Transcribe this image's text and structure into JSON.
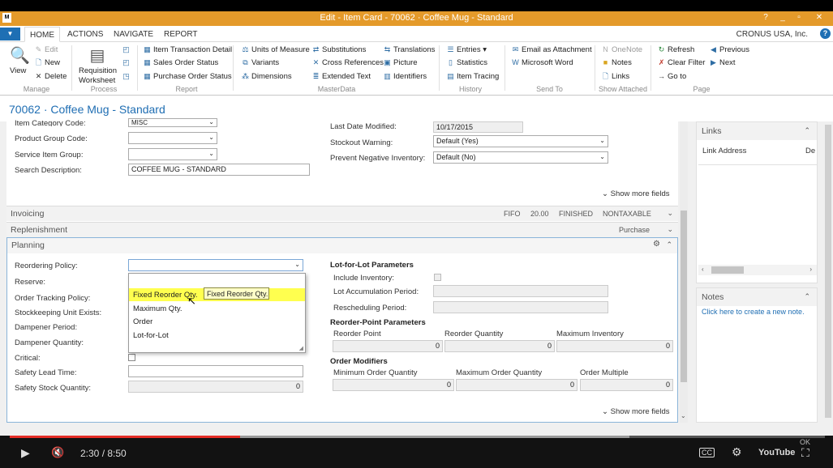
{
  "window": {
    "title": "Edit - Item Card - 70062 · Coffee Mug - Standard",
    "controls": [
      "?",
      "_",
      "▫",
      "✕"
    ]
  },
  "ribbon_tabs": {
    "app_menu_icon": "▼",
    "tabs": [
      "HOME",
      "ACTIONS",
      "NAVIGATE",
      "REPORT"
    ],
    "company": "CRONUS USA, Inc.",
    "help": "?"
  },
  "ribbon": {
    "manage": {
      "view": "View",
      "edit": "Edit",
      "new": "New",
      "delete": "Delete",
      "group": "Manage"
    },
    "process": {
      "requisition": "Requisition",
      "worksheet": "Worksheet",
      "group": "Process"
    },
    "report": {
      "items": [
        "Item Transaction Detail",
        "Sales Order Status",
        "Purchase Order Status"
      ],
      "group": "Report"
    },
    "masterdata": {
      "col1": [
        "Units of Measure",
        "Variants",
        "Dimensions"
      ],
      "col2": [
        "Substitutions",
        "Cross References",
        "Extended Text"
      ],
      "col3": [
        "Translations",
        "Picture",
        "Identifiers"
      ],
      "group": "MasterData"
    },
    "history": {
      "items": [
        "Entries ▾",
        "Statistics",
        "Item Tracing"
      ],
      "group": "History"
    },
    "sendto": {
      "items": [
        "Email as Attachment",
        "Microsoft Word"
      ],
      "group": "Send To"
    },
    "showattached": {
      "items": [
        "OneNote",
        "Notes",
        "Links"
      ],
      "group": "Show Attached"
    },
    "page": {
      "col1": [
        "Refresh",
        "Clear Filter",
        "Go to"
      ],
      "col2": [
        "Previous",
        "Next"
      ],
      "group": "Page"
    }
  },
  "page_title": "70062 · Coffee Mug - Standard",
  "general": {
    "item_category_label": "Item Category Code:",
    "item_category_value": "MISC",
    "product_group_label": "Product Group Code:",
    "service_item_group_label": "Service Item Group:",
    "search_description_label": "Search Description:",
    "search_description_value": "COFFEE MUG - STANDARD",
    "last_modified_label": "Last Date Modified:",
    "last_modified_value": "10/17/2015",
    "stockout_label": "Stockout Warning:",
    "stockout_value": "Default (Yes)",
    "prevent_negative_label": "Prevent Negative Inventory:",
    "prevent_negative_value": "Default (No)",
    "show_more": "Show more fields"
  },
  "invoicing": {
    "title": "Invoicing",
    "summary": [
      "FIFO",
      "20.00",
      "FINISHED",
      "NONTAXABLE"
    ]
  },
  "replenishment": {
    "title": "Replenishment",
    "summary": "Purchase"
  },
  "planning": {
    "title": "Planning",
    "labels": {
      "reordering_policy": "Reordering Policy:",
      "reserve": "Reserve:",
      "order_tracking": "Order Tracking Policy:",
      "sku_exists": "Stockkeeping Unit Exists:",
      "dampener_period": "Dampener Period:",
      "dampener_qty": "Dampener Quantity:",
      "critical": "Critical:",
      "safety_lead_time": "Safety Lead Time:",
      "safety_stock_qty": "Safety Stock Quantity:"
    },
    "safety_stock_qty_value": "0",
    "dropdown_options": [
      "Fixed Reorder Qty.",
      "Maximum Qty.",
      "Order",
      "Lot-for-Lot"
    ],
    "tooltip": "Fixed Reorder Qty.",
    "lot_for_lot": {
      "header": "Lot-for-Lot Parameters",
      "include_inventory": "Include Inventory:",
      "lot_accumulation": "Lot Accumulation Period:",
      "rescheduling": "Rescheduling Period:"
    },
    "reorder_point": {
      "header": "Reorder-Point Parameters",
      "cols": [
        "Reorder Point",
        "Reorder Quantity",
        "Maximum Inventory"
      ],
      "values": [
        "0",
        "0",
        "0"
      ]
    },
    "order_modifiers": {
      "header": "Order Modifiers",
      "cols": [
        "Minimum Order Quantity",
        "Maximum Order Quantity",
        "Order Multiple"
      ],
      "values": [
        "0",
        "0",
        "0"
      ]
    },
    "show_more": "Show more fields"
  },
  "factbox_links": {
    "title": "Links",
    "col1": "Link Address",
    "col2": "De"
  },
  "factbox_notes": {
    "title": "Notes",
    "link": "Click here to create a new note."
  },
  "player": {
    "time": "2:30 / 8:50",
    "progress_fraction": 0.283,
    "buffered_fraction": 0.76,
    "cc": "CC",
    "youtube": "YouTube",
    "ok": "OK"
  },
  "colors": {
    "titlebar": "#e49a2a",
    "accent": "#1f6eb3",
    "highlight": "#ffff4f",
    "progress": "#e52d27"
  }
}
